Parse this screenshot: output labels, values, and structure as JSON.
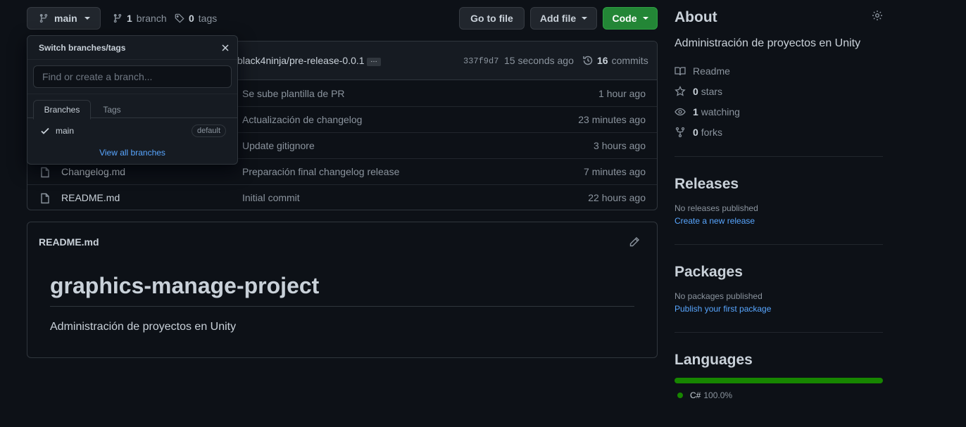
{
  "toolbar": {
    "branch": "main",
    "branch_count": "1",
    "branch_label": "branch",
    "tag_count": "0",
    "tag_label": "tags",
    "go_to_file": "Go to file",
    "add_file": "Add file",
    "code": "Code"
  },
  "commit_bar": {
    "message": "black4ninja/pre-release-0.0.1",
    "ellipsis": "…",
    "hash": "337f9d7",
    "time": "15 seconds ago",
    "commit_count": "16",
    "commit_label": "commits"
  },
  "files": [
    {
      "name": "",
      "message": "Se sube plantilla de PR",
      "age": "1 hour ago"
    },
    {
      "name": "",
      "message": "Actualización de changelog",
      "age": "23 minutes ago"
    },
    {
      "name": "",
      "message": "Update gitignore",
      "age": "3 hours ago"
    },
    {
      "name": "Changelog.md",
      "message": "Preparación final changelog release",
      "age": "7 minutes ago"
    },
    {
      "name": "README.md",
      "message": "Initial commit",
      "age": "22 hours ago"
    }
  ],
  "readme": {
    "file_title": "README.md",
    "heading": "graphics-manage-project",
    "body": "Administración de proyectos en Unity"
  },
  "dropdown": {
    "title": "Switch branches/tags",
    "placeholder": "Find or create a branch...",
    "tab_branches": "Branches",
    "tab_tags": "Tags",
    "branch_item": "main",
    "badge": "default",
    "view_all": "View all branches"
  },
  "about": {
    "heading": "About",
    "description": "Administración de proyectos en Unity",
    "readme": "Readme",
    "stars_count": "0",
    "stars_label": "stars",
    "watching_count": "1",
    "watching_label": "watching",
    "forks_count": "0",
    "forks_label": "forks"
  },
  "releases": {
    "heading": "Releases",
    "none": "No releases published",
    "link": "Create a new release"
  },
  "packages": {
    "heading": "Packages",
    "none": "No packages published",
    "link": "Publish your first package"
  },
  "languages": {
    "heading": "Languages",
    "items": [
      {
        "name": "C#",
        "percent": "100.0%",
        "color": "#178600"
      }
    ]
  },
  "colors": {
    "accent_link": "#58a6ff",
    "primary_button": "#238636",
    "background": "#0d1117"
  }
}
